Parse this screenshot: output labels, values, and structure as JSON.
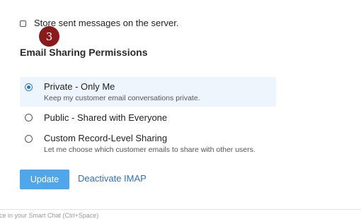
{
  "store_messages": {
    "label": "Store sent messages on the server.",
    "checked": false
  },
  "step_badge": "3",
  "section_title": "Email Sharing Permissions",
  "sharing_options": [
    {
      "title": "Private - Only Me",
      "description": "Keep my customer email conversations private.",
      "selected": true
    },
    {
      "title": "Public - Shared with Everyone",
      "description": "",
      "selected": false
    },
    {
      "title": "Custom Record-Level Sharing",
      "description": "Let me choose which customer emails to share with other users.",
      "selected": false
    }
  ],
  "actions": {
    "update_label": "Update",
    "deactivate_label": "Deactivate IMAP"
  },
  "footer_hint": "ace in your Smart Chat (Ctrl+Space)",
  "colors": {
    "accent": "#1f73d6",
    "button": "#4fa6e8",
    "badge": "#8b1a1a",
    "selected_bg": "#eef5fc"
  }
}
